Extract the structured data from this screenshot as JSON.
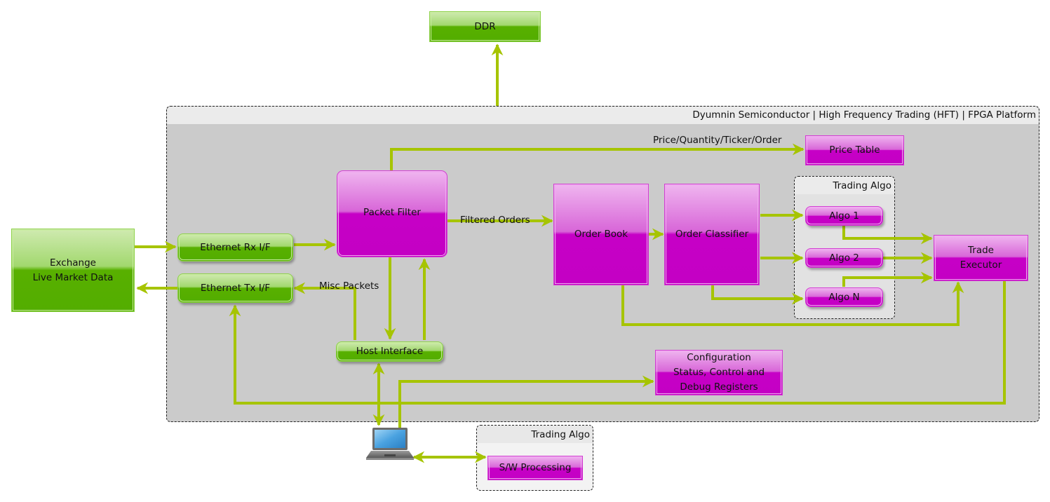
{
  "diagram": {
    "platform": {
      "title": "Dyumnin Semiconductor | High Frequency Trading (HFT) |  FPGA Platform"
    },
    "external": {
      "ddr": "DDR",
      "exchange_line1": "Exchange",
      "exchange_line2": "Live Market Data",
      "host_pc_icon": "laptop-icon"
    },
    "blocks": {
      "ethernet_rx": "Ethernet Rx I/F",
      "ethernet_tx": "Ethernet Tx I/F",
      "packet_filter": "Packet Filter",
      "host_interface": "Host Interface",
      "price_table": "Price Table",
      "order_book": "Order Book",
      "order_classifier": "Order Classifier",
      "algo_1": "Algo 1",
      "algo_2": "Algo 2",
      "algo_n": "Algo N",
      "trade_executor_line1": "Trade",
      "trade_executor_line2": "Executor",
      "config_line1": "Configuration",
      "config_line2": "Status, Control and",
      "config_line3": "Debug Registers"
    },
    "groups": {
      "trading_algo_hw": "Trading Algo",
      "trading_algo_sw": "Trading Algo",
      "sw_processing": "S/W Processing"
    },
    "edge_labels": {
      "price_qty": "Price/Quantity/Ticker/Order",
      "filtered_orders": "Filtered Orders",
      "misc_packets": "Misc Packets"
    },
    "colors": {
      "hardware_block": "#c400c4",
      "interface_block": "#53ad00",
      "wire": "#a6c400",
      "platform_bg": "#cbcbcb",
      "platform_header": "#ebebeb"
    }
  }
}
